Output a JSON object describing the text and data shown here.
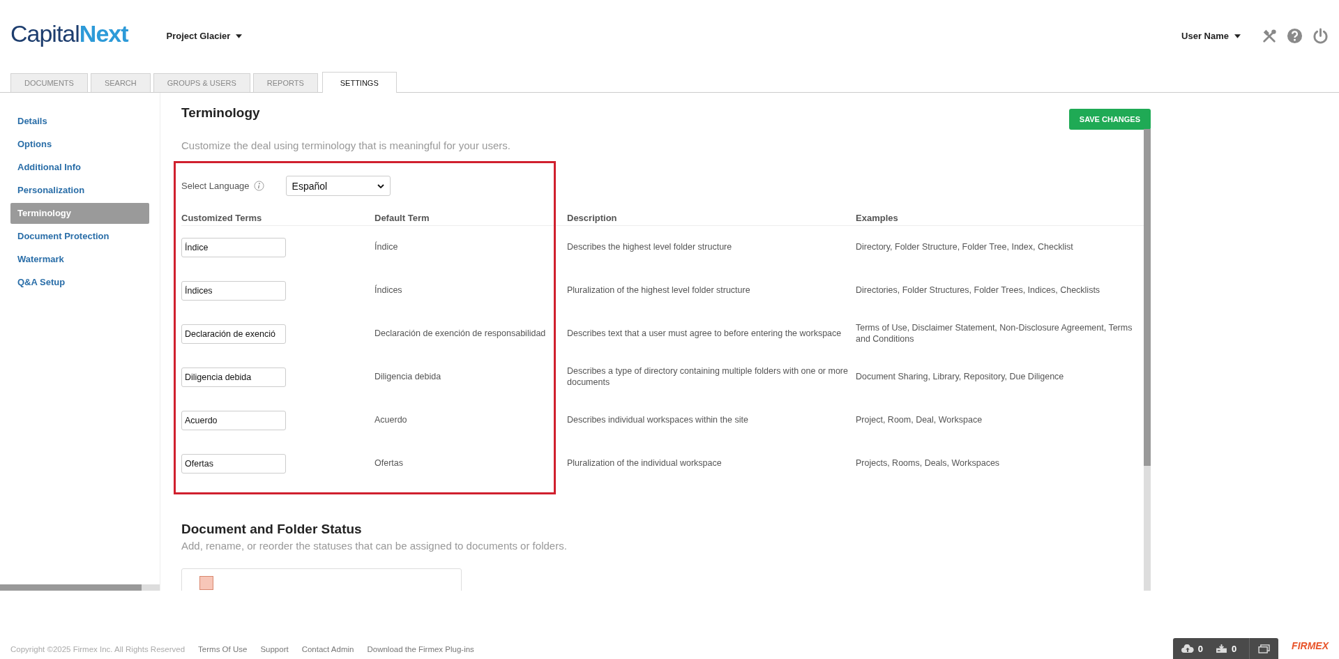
{
  "logo": {
    "first": "Capital",
    "second": "Next"
  },
  "project": {
    "label": "Project Glacier"
  },
  "user": {
    "name": "User Name"
  },
  "tabs": [
    {
      "label": "DOCUMENTS",
      "selected": false
    },
    {
      "label": "SEARCH",
      "selected": false
    },
    {
      "label": "GROUPS & USERS",
      "selected": false
    },
    {
      "label": "REPORTS",
      "selected": false
    },
    {
      "label": "SETTINGS",
      "selected": true
    }
  ],
  "sidebar": {
    "items": [
      {
        "label": "Details",
        "selected": false
      },
      {
        "label": "Options",
        "selected": false
      },
      {
        "label": "Additional Info",
        "selected": false
      },
      {
        "label": "Personalization",
        "selected": false
      },
      {
        "label": "Terminology",
        "selected": true
      },
      {
        "label": "Document Protection",
        "selected": false
      },
      {
        "label": "Watermark",
        "selected": false
      },
      {
        "label": "Q&A Setup",
        "selected": false
      }
    ]
  },
  "terminology": {
    "title": "Terminology",
    "description": "Customize the deal using terminology that is meaningful for your users.",
    "save_button": "SAVE CHANGES",
    "language": {
      "label": "Select Language",
      "value": "Español"
    },
    "columns": [
      "Customized Terms",
      "Default Term",
      "Description",
      "Examples"
    ],
    "rows": [
      {
        "custom": "Índice",
        "default": "Índice",
        "description": "Describes the highest level folder structure",
        "examples": "Directory, Folder Structure, Folder Tree, Index, Checklist"
      },
      {
        "custom": "Índices",
        "default": "Índices",
        "description": "Pluralization of the highest level folder structure",
        "examples": "Directories, Folder Structures, Folder Trees, Indices, Checklists"
      },
      {
        "custom": "Declaración de exenció",
        "default": "Declaración de exención de responsabilidad",
        "description": "Describes text that a user must agree to before entering the workspace",
        "examples": "Terms of Use, Disclaimer Statement, Non-Disclosure Agreement, Terms and Conditions"
      },
      {
        "custom": "Diligencia debida",
        "default": "Diligencia debida",
        "description": "Describes a type of directory containing multiple folders with one or more documents",
        "examples": "Document Sharing, Library, Repository, Due Diligence"
      },
      {
        "custom": "Acuerdo",
        "default": "Acuerdo",
        "description": "Describes individual workspaces within the site",
        "examples": "Project, Room, Deal, Workspace"
      },
      {
        "custom": "Ofertas",
        "default": "Ofertas",
        "description": "Pluralization of the individual workspace",
        "examples": "Projects, Rooms, Deals, Workspaces"
      }
    ]
  },
  "status_section": {
    "title": "Document and Folder Status",
    "description": "Add, rename, or reorder the statuses that can be assigned to documents or folders."
  },
  "footer": {
    "copyright": "Copyright ©2025 Firmex Inc. All Rights Reserved",
    "links": [
      "Terms Of Use",
      "Support",
      "Contact Admin",
      "Download the Firmex Plug-ins"
    ],
    "uploads": "0",
    "downloads": "0",
    "brand": "FIRMEX"
  }
}
